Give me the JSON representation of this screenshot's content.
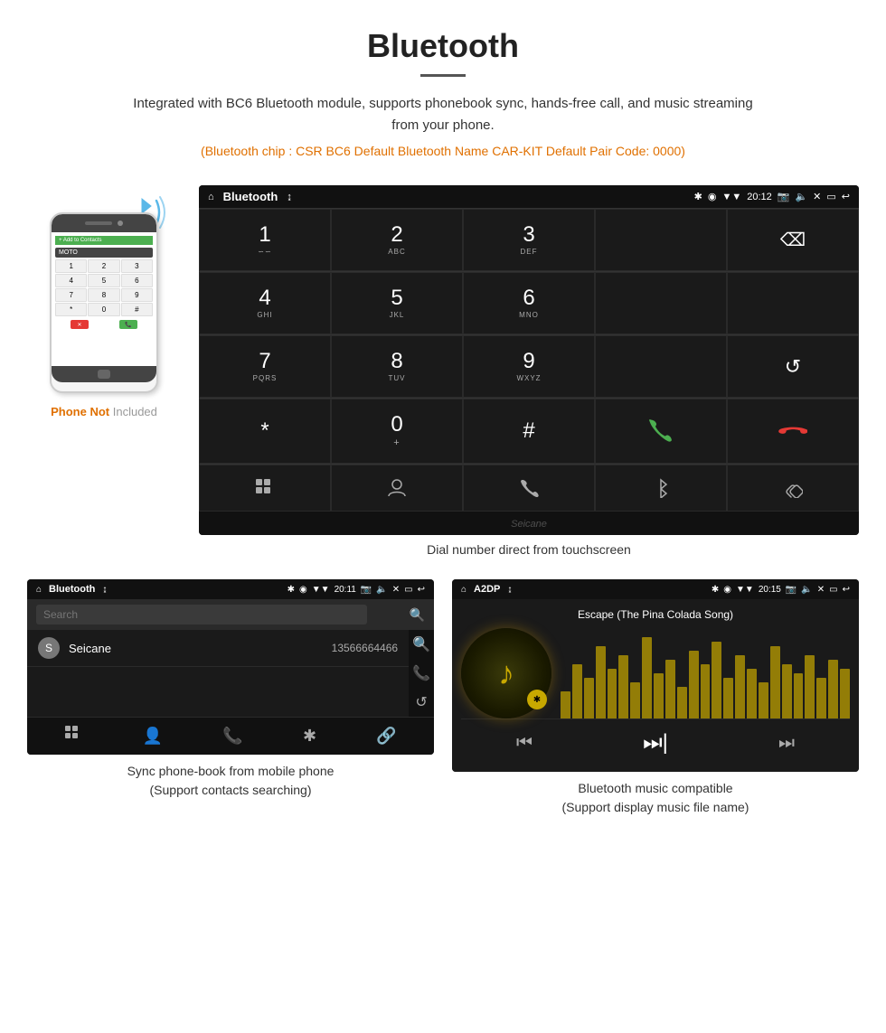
{
  "page": {
    "title": "Bluetooth",
    "description": "Integrated with BC6 Bluetooth module, supports phonebook sync, hands-free call, and music streaming from your phone.",
    "specs": "(Bluetooth chip : CSR BC6    Default Bluetooth Name CAR-KIT    Default Pair Code: 0000)",
    "main_caption": "Dial number direct from touchscreen",
    "phone_label_not": "Phone Not",
    "phone_label_included": "Included"
  },
  "dial_screen": {
    "status_bar": {
      "home_icon": "⌂",
      "title": "Bluetooth",
      "usb": "↨",
      "time": "20:12",
      "icons": "✱ ◉ ▼ 📷 🔈 ✕ ▭ ↩"
    },
    "keys": [
      {
        "main": "1",
        "sub": "∽∽"
      },
      {
        "main": "2",
        "sub": "ABC"
      },
      {
        "main": "3",
        "sub": "DEF"
      },
      {
        "main": "",
        "sub": ""
      },
      {
        "main": "⌫",
        "sub": ""
      },
      {
        "main": "4",
        "sub": "GHI"
      },
      {
        "main": "5",
        "sub": "JKL"
      },
      {
        "main": "6",
        "sub": "MNO"
      },
      {
        "main": "",
        "sub": ""
      },
      {
        "main": "",
        "sub": ""
      },
      {
        "main": "7",
        "sub": "PQRS"
      },
      {
        "main": "8",
        "sub": "TUV"
      },
      {
        "main": "9",
        "sub": "WXYZ"
      },
      {
        "main": "",
        "sub": ""
      },
      {
        "main": "↺",
        "sub": ""
      },
      {
        "main": "*",
        "sub": ""
      },
      {
        "main": "0",
        "sub": "+"
      },
      {
        "main": "#",
        "sub": ""
      },
      {
        "main": "📞",
        "sub": "green"
      },
      {
        "main": "📵",
        "sub": "red"
      }
    ],
    "bottom_icons": [
      "⊞",
      "👤",
      "📞",
      "✱",
      "🔗"
    ],
    "watermark": "Seicane"
  },
  "phonebook_screen": {
    "status_bar": {
      "home": "⌂",
      "title": "Bluetooth",
      "usb": "↨",
      "time": "20:11",
      "icons": "✱ ◉ ▼ 📷 🔈 ✕ ▭ ↩"
    },
    "search_placeholder": "Search",
    "contacts": [
      {
        "letter": "S",
        "name": "Seicane",
        "number": "13566664466"
      }
    ],
    "side_icons": [
      "🔍",
      "📞",
      "↺"
    ],
    "bottom_icons": [
      "⊞",
      "👤",
      "📞",
      "✱",
      "🔗"
    ],
    "caption_line1": "Sync phone-book from mobile phone",
    "caption_line2": "(Support contacts searching)"
  },
  "music_screen": {
    "status_bar": {
      "home": "⌂",
      "title": "A2DP",
      "usb": "↨",
      "time": "20:15",
      "icons": "✱ ◉ ▼ 📷 🔈 ✕ ▭ ↩"
    },
    "song_title": "Escape (The Pina Colada Song)",
    "eq_bars": [
      30,
      60,
      45,
      80,
      55,
      70,
      40,
      90,
      50,
      65,
      35,
      75,
      60,
      85,
      45,
      70,
      55,
      40,
      80,
      60,
      50,
      70,
      45,
      65,
      55
    ],
    "controls": [
      "⏮",
      "⏭|",
      "⏭"
    ],
    "caption_line1": "Bluetooth music compatible",
    "caption_line2": "(Support display music file name)"
  },
  "colors": {
    "orange": "#e07000",
    "green_call": "#4caf50",
    "red_call": "#e53935",
    "screen_bg": "#1a1a1a",
    "status_bg": "#111",
    "gold": "#c8a800"
  }
}
